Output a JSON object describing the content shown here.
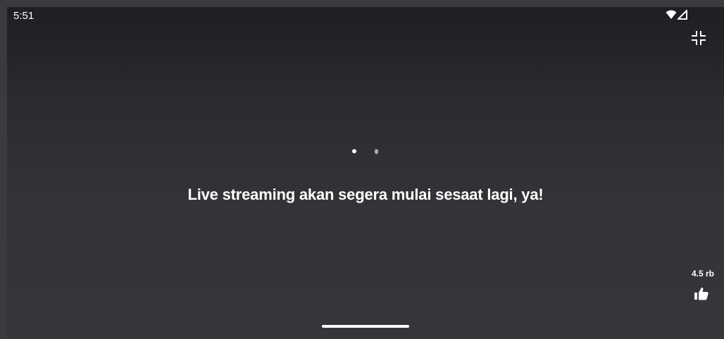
{
  "status_bar": {
    "time": "5:51",
    "icons": [
      "wifi-icon",
      "cellular-signal-icon"
    ]
  },
  "player": {
    "collapse_icon": "fullscreen-exit-icon",
    "message": "Live streaming akan segera mulai sesaat lagi, ya!",
    "likes": {
      "count": "4.5 rb",
      "icon": "thumbs-up-icon"
    }
  },
  "colors": {
    "background_top": "#1e1f22",
    "background_bottom": "#34363a",
    "text": "#ffffff"
  }
}
